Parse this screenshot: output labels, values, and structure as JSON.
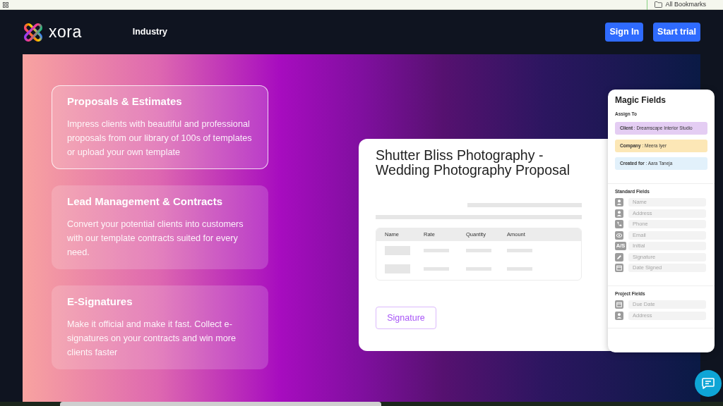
{
  "bookmarks_bar": {
    "label": "All Bookmarks"
  },
  "navbar": {
    "brand": "xora",
    "links": [
      {
        "label": "Industry"
      }
    ],
    "buttons": [
      {
        "label": "Sign In"
      },
      {
        "label": "Start trial"
      }
    ]
  },
  "features": [
    {
      "title": "Proposals & Estimates",
      "description": "Impress clients with beautiful and professional proposals from our library of 100s of templates or upload your own template",
      "selected": true
    },
    {
      "title": "Lead Management & Contracts",
      "description": "Convert your potential clients into customers with our template contracts suited for every need.",
      "selected": false
    },
    {
      "title": "E-Signatures",
      "description": "Make it official and make it fast. Collect e-signatures on your contracts and win more clients faster",
      "selected": false
    }
  ],
  "proposal": {
    "title": "Shutter Bliss Photography - Wedding Photography Proposal",
    "table": {
      "columns": [
        "Name",
        "Rate",
        "Quantity",
        "Amount"
      ],
      "rows": [
        {
          "kind": "placeholder"
        },
        {
          "kind": "placeholder"
        }
      ]
    },
    "button": "Signature"
  },
  "magic_fields": {
    "title": "Magic Fields",
    "assign_label": "Assign To",
    "assignments": [
      {
        "text": "**Client** : Dreamscape Interior Studio",
        "color": "#e4cdf3"
      },
      {
        "text": "**Company** : Meera Iyer",
        "color": "#fce7b6"
      },
      {
        "text": "**Created for** : Aara Taneja",
        "color": "#e2f1fb"
      }
    ],
    "sections": [
      {
        "title": "Standard Fields",
        "fields": [
          {
            "placeholder": "Name"
          },
          {
            "placeholder": "Address"
          },
          {
            "placeholder": "Phone"
          },
          {
            "placeholder": "Email"
          },
          {
            "placeholder": "Initial",
            "badge": "A/S"
          },
          {
            "placeholder": "Signature"
          },
          {
            "placeholder": "Date Signed"
          }
        ]
      },
      {
        "title": "Project Fields",
        "fields": [
          {
            "placeholder": "Due Date"
          },
          {
            "placeholder": "Address"
          }
        ]
      }
    ]
  }
}
